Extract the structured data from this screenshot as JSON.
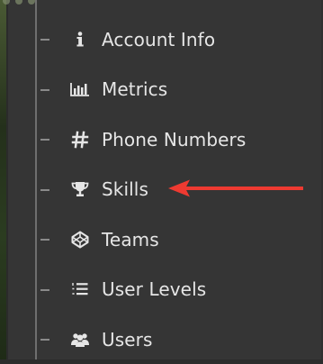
{
  "menu": {
    "items": [
      {
        "label": "Account Info",
        "icon": "info-icon"
      },
      {
        "label": "Metrics",
        "icon": "bar-chart-icon"
      },
      {
        "label": "Phone Numbers",
        "icon": "hash-icon"
      },
      {
        "label": "Skills",
        "icon": "trophy-icon"
      },
      {
        "label": "Teams",
        "icon": "codepen-icon"
      },
      {
        "label": "User Levels",
        "icon": "list-icon"
      },
      {
        "label": "Users",
        "icon": "users-icon"
      }
    ]
  },
  "annotation": {
    "color": "#ee3a31",
    "points_to": "Skills"
  },
  "colors": {
    "background": "#353535",
    "text": "#e6e6e6",
    "tree_line": "#6f6f6f"
  }
}
